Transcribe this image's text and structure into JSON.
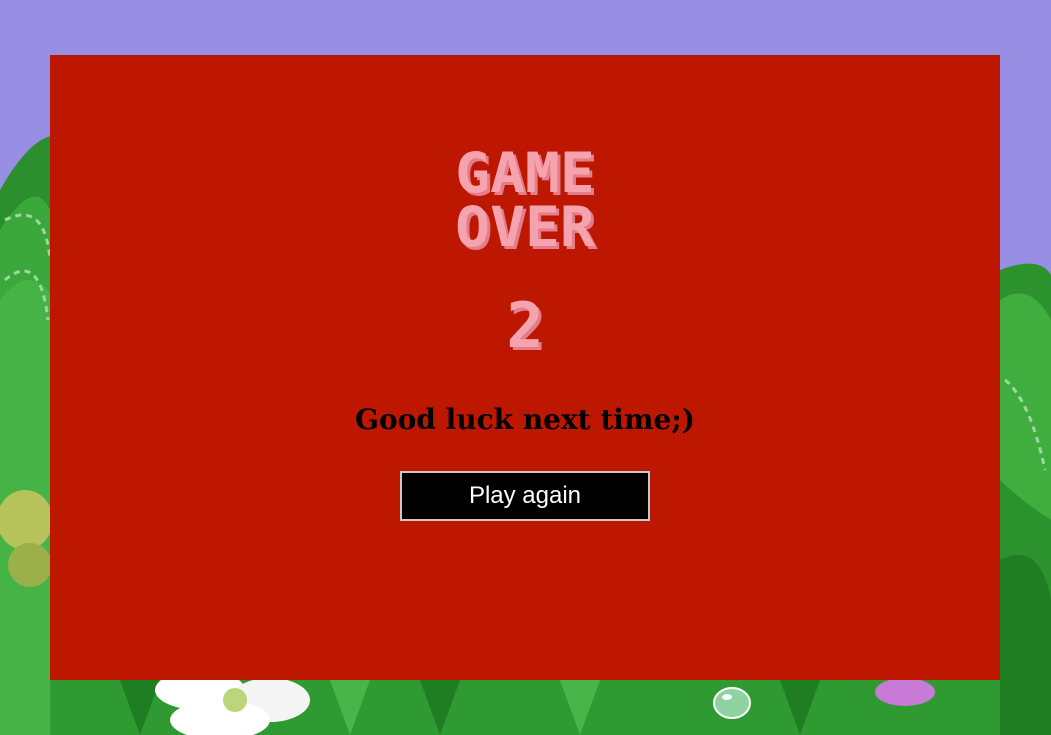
{
  "game_over": {
    "title_line1": "GAME",
    "title_line2": "OVER",
    "score": "2",
    "message": "Good luck next time;)",
    "play_again_label": "Play again"
  },
  "colors": {
    "background_sky": "#988ee3",
    "modal_background": "#bd1700",
    "title_color": "#f5a3ae",
    "button_background": "#000000",
    "button_text": "#ffffff"
  }
}
